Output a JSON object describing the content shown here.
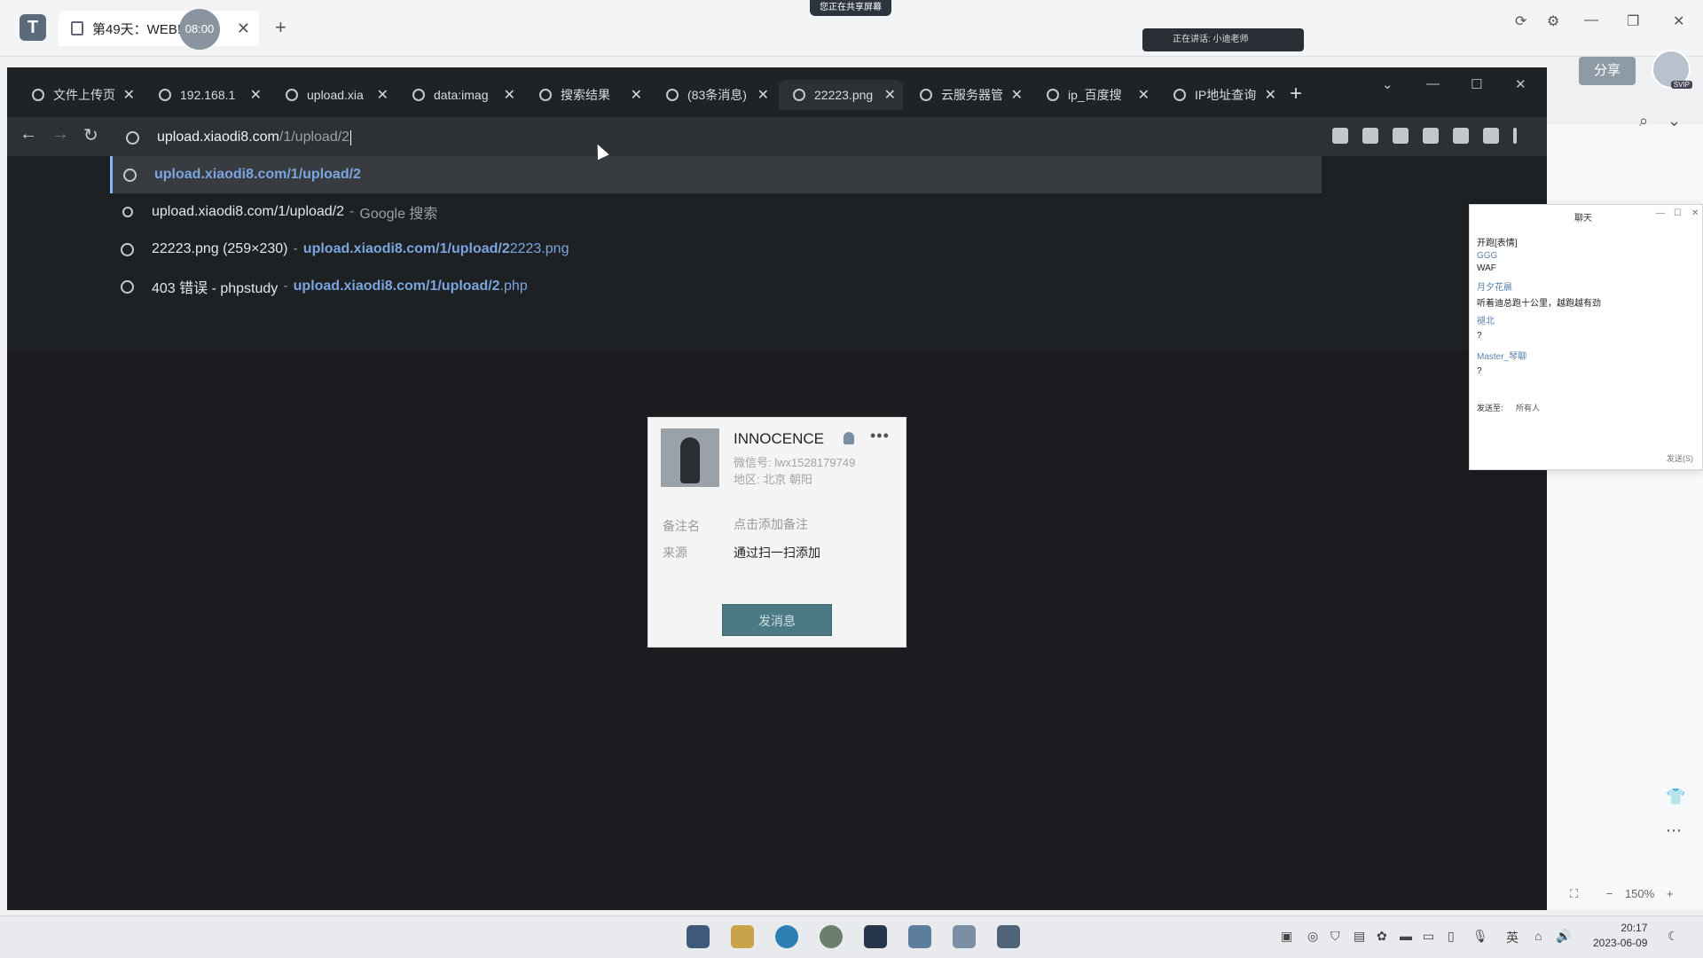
{
  "outer": {
    "tab_title": "第49天：WEB!",
    "timer": "08:00",
    "share_indicator": "您正在共享屏幕",
    "speaking_indicator": "正在讲话: 小迪老师",
    "share_button": "分享",
    "svip_badge": "SVIP"
  },
  "browser": {
    "tabs": [
      {
        "label": "文件上传页"
      },
      {
        "label": "192.168.1"
      },
      {
        "label": "upload.xia"
      },
      {
        "label": "data:imag"
      },
      {
        "label": "搜索结果"
      },
      {
        "label": "(83条消息)"
      },
      {
        "label": "22223.png"
      },
      {
        "label": "云服务器管"
      },
      {
        "label": "ip_百度搜"
      },
      {
        "label": "IP地址查询"
      }
    ],
    "omnibox": {
      "host": "upload.xiaodi8.com",
      "path": "/1/upload/2"
    },
    "suggestions": [
      {
        "main": "upload.xiaodi8.com/1/upload/2",
        "sep": "",
        "url_bold": "",
        "url_rest": ""
      },
      {
        "main": "upload.xiaodi8.com/1/upload/2",
        "sep": "-",
        "url_bold": "",
        "url_rest": "Google 搜索"
      },
      {
        "main": "22223.png (259×230)",
        "sep": "-",
        "url_bold": "upload.xiaodi8.com/1/upload/2",
        "url_rest": "2223.png"
      },
      {
        "main": "403 错误 - phpstudy",
        "sep": "-",
        "url_bold": "upload.xiaodi8.com/1/upload/2",
        "url_rest": ".php"
      }
    ]
  },
  "wechat_card": {
    "name": "INNOCENCE",
    "wechat_id": "微信号: lwx1528179749",
    "region": "地区: 北京 朝阳",
    "remark_label": "备注名",
    "remark_value": "点击添加备注",
    "source_label": "来源",
    "source_value": "通过扫一扫添加",
    "button": "发消息"
  },
  "chat": {
    "title": "聊天",
    "messages": [
      {
        "text": "开跑[表情]",
        "type": "msg"
      },
      {
        "text": "GGG",
        "type": "uname"
      },
      {
        "text": "WAF",
        "type": "msg"
      },
      {
        "text": "月夕花晨",
        "type": "uname"
      },
      {
        "text": "听着迪总跑十公里，越跑越有劲",
        "type": "msg"
      },
      {
        "text": "褪北",
        "type": "uname"
      },
      {
        "text": "?",
        "type": "msg"
      },
      {
        "text": "Master_琴聊",
        "type": "uname"
      },
      {
        "text": "?",
        "type": "msg"
      }
    ],
    "send_to_label": "发送至:",
    "send_to_value": "所有人",
    "send_button": "发送(S)"
  },
  "zoom": "150%",
  "taskbar": {
    "ime": "英",
    "time": "20:17",
    "date": "2023-06-09"
  }
}
